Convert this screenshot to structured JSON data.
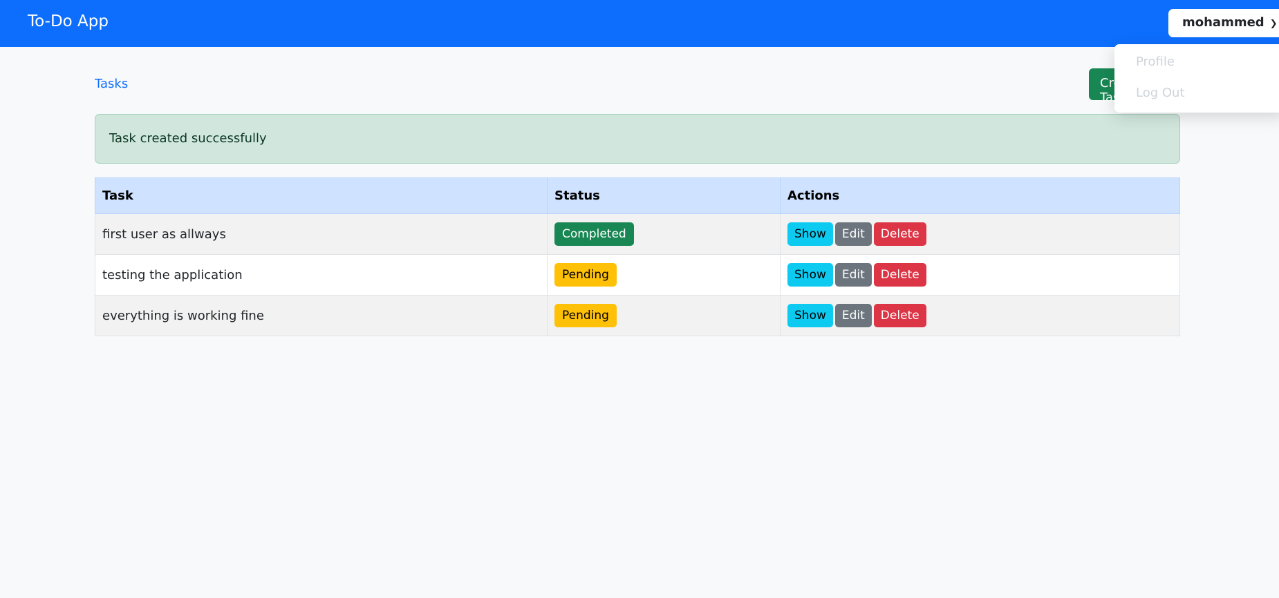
{
  "navbar": {
    "brand": "To-Do App",
    "user": "mohammed"
  },
  "dropdown": {
    "items": [
      "Profile",
      "Log Out"
    ]
  },
  "page": {
    "breadcrumb": "Tasks",
    "create_label": "Create Task"
  },
  "alert": "Task created successfully",
  "table": {
    "headers": [
      "Task",
      "Status",
      "Actions"
    ],
    "rows": [
      {
        "task": "first user as allways",
        "status": "Completed"
      },
      {
        "task": "testing the application",
        "status": "Pending"
      },
      {
        "task": "everything is working fine",
        "status": "Pending"
      }
    ],
    "actions": {
      "show": "Show",
      "edit": "Edit",
      "delete": "Delete"
    }
  },
  "colors": {
    "primary": "#0d6efd",
    "success": "#198754",
    "warning": "#ffc107",
    "info": "#0dcaf0",
    "secondary": "#6c757d",
    "danger": "#dc3545"
  }
}
